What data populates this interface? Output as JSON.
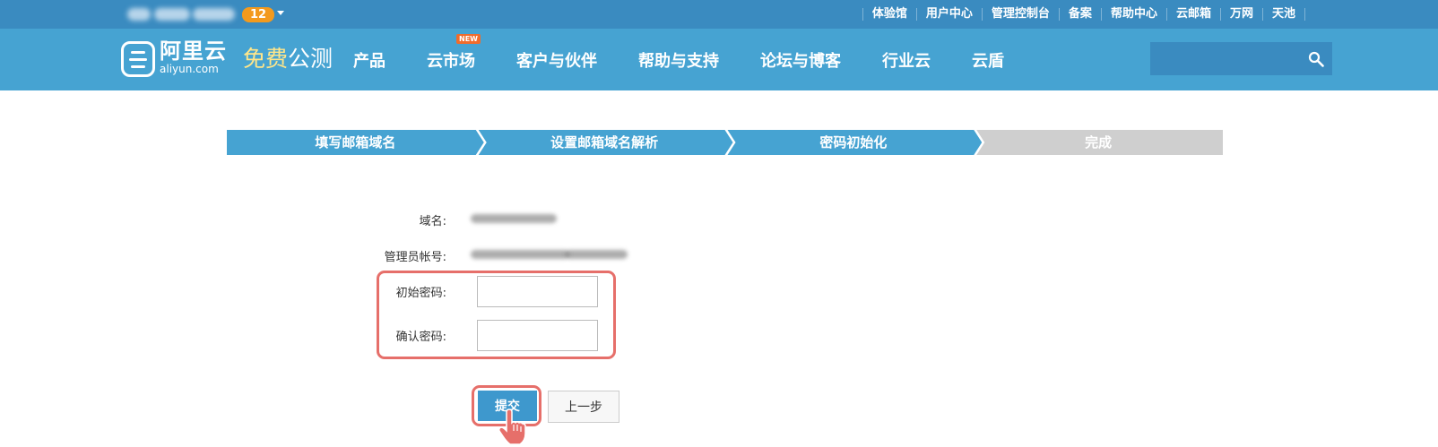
{
  "topbar": {
    "message_count": "12",
    "links": [
      "体验馆",
      "用户中心",
      "管理控制台",
      "备案",
      "帮助中心",
      "云邮箱",
      "万网",
      "天池"
    ]
  },
  "nav": {
    "logo_cn": "阿里云",
    "logo_en": "aliyun.com",
    "promo_highlight": "免费",
    "promo_normal": "公测",
    "items": [
      {
        "label": "产品"
      },
      {
        "label": "云市场",
        "badge": "NEW"
      },
      {
        "label": "客户与伙伴"
      },
      {
        "label": "帮助与支持"
      },
      {
        "label": "论坛与博客"
      },
      {
        "label": "行业云"
      },
      {
        "label": "云盾"
      }
    ],
    "search_placeholder": ""
  },
  "steps": {
    "items": [
      {
        "label": "填写邮箱域名",
        "status": "done"
      },
      {
        "label": "设置邮箱域名解析",
        "status": "done"
      },
      {
        "label": "密码初始化",
        "status": "current"
      },
      {
        "label": "完成",
        "status": "pending"
      }
    ],
    "colors": {
      "active": "#46a3d2",
      "pending": "#cfcfcf"
    }
  },
  "form": {
    "domain_label": "域名:",
    "admin_label": "管理员帐号:",
    "init_pwd_label": "初始密码:",
    "confirm_pwd_label": "确认密码:",
    "init_pwd_value": "",
    "confirm_pwd_value": "",
    "submit_label": "提交",
    "prev_label": "上一步"
  },
  "colors": {
    "topbar": "#3a8bc0",
    "nav": "#46a3d2",
    "promo_highlight": "#ffe68a",
    "badge": "#f39a1e",
    "annotation": "#e66f6a"
  },
  "icons": {
    "search": "search-icon",
    "dropdown": "chevron-down-icon",
    "cursor": "hand-pointer-icon"
  }
}
